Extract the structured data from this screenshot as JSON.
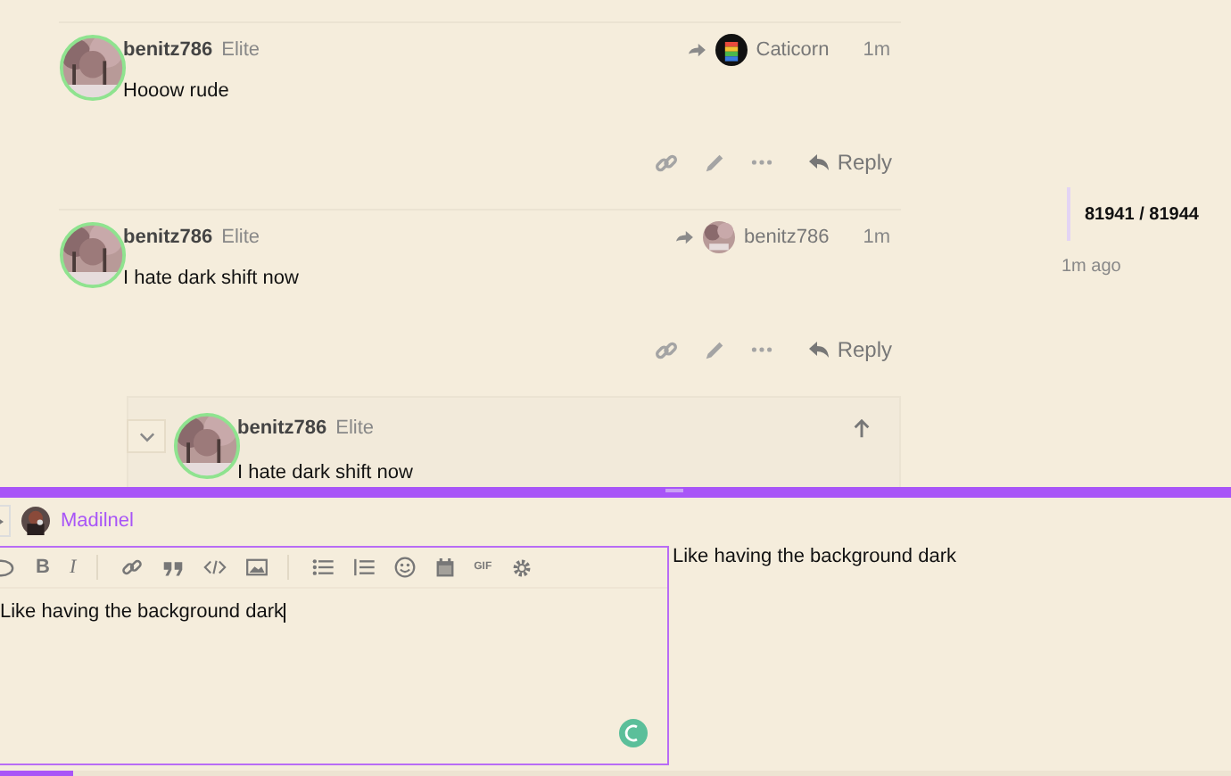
{
  "posts": [
    {
      "username": "benitz786",
      "title": "Elite",
      "reply_to": {
        "username": "Caticorn",
        "kind": "cat"
      },
      "time": "1m",
      "text": "Hooow rude",
      "reply_label": "Reply"
    },
    {
      "username": "benitz786",
      "title": "Elite",
      "reply_to": {
        "username": "benitz786",
        "kind": "tree"
      },
      "time": "1m",
      "text": "I hate dark shift now",
      "reply_label": "Reply"
    }
  ],
  "nested_reply": {
    "username": "benitz786",
    "title": "Elite",
    "text": "I hate dark shift now",
    "expanded": true
  },
  "timeline": {
    "position": "81941 / 81944",
    "date": "1m ago"
  },
  "composer": {
    "reply_to": "Madilnel",
    "bold_label": "B",
    "italic_label": "I",
    "gif_label": "GIF",
    "progress": {
      "level": 0.06
    },
    "value": "Like having the background dark",
    "preview": "Like having the background dark"
  }
}
